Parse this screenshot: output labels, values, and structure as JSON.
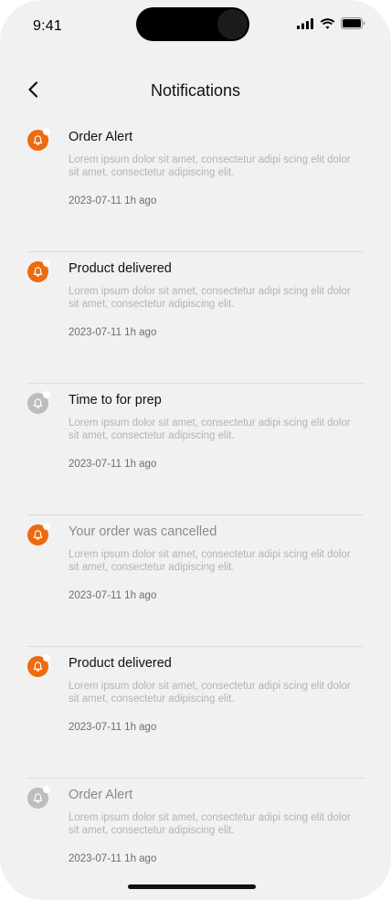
{
  "status_bar": {
    "time": "9:41"
  },
  "header": {
    "title": "Notifications",
    "back_icon": "chevron-left-icon"
  },
  "colors": {
    "accent": "#ee6a10",
    "inactive": "#bdbdbd"
  },
  "notifications": [
    {
      "title": "Order Alert",
      "body": "Lorem ipsum dolor sit amet, consectetur adipi scing elit dolor sit amet, consectetur adipiscing elit.",
      "meta": "2023-07-11 1h ago",
      "active": true,
      "read": false
    },
    {
      "title": "Product delivered",
      "body": "Lorem ipsum dolor sit amet, consectetur adipi scing elit dolor sit amet, consectetur adipiscing elit.",
      "meta": "2023-07-11 1h ago",
      "active": true,
      "read": false
    },
    {
      "title": "Time to for prep",
      "body": "Lorem ipsum dolor sit amet, consectetur adipi scing elit dolor sit amet, consectetur adipiscing elit.",
      "meta": "2023-07-11 1h ago",
      "active": false,
      "read": false
    },
    {
      "title": "Your order was cancelled",
      "body": "Lorem ipsum dolor sit amet, consectetur adipi scing elit dolor sit amet, consectetur adipiscing elit.",
      "meta": "2023-07-11 1h ago",
      "active": true,
      "read": true
    },
    {
      "title": "Product delivered",
      "body": "Lorem ipsum dolor sit amet, consectetur adipi scing elit dolor sit amet, consectetur adipiscing elit.",
      "meta": "2023-07-11 1h ago",
      "active": true,
      "read": false
    },
    {
      "title": "Order Alert",
      "body": "Lorem ipsum dolor sit amet, consectetur adipi scing elit dolor sit amet, consectetur adipiscing elit.",
      "meta": "2023-07-11 1h ago",
      "active": false,
      "read": true
    }
  ]
}
